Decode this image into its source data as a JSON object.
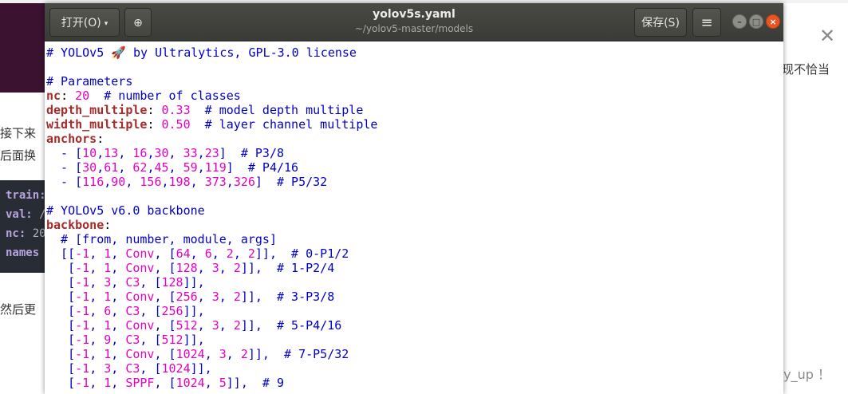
{
  "background_page": {
    "side_text": [
      "接下来",
      "后面换"
    ],
    "side_text_bottom": "然后更",
    "right_fragment": "现不恰当",
    "code_lines": [
      {
        "key": "train:",
        "val": " /"
      },
      {
        "key": "val:",
        "val": " /ho"
      },
      {
        "key": "nc:",
        "val": " 20"
      },
      {
        "key": "names",
        "val": ""
      }
    ],
    "close_glyph": "✕",
    "watermark": "CSDN @day_day_up ！"
  },
  "window": {
    "open_label": "打开(O)",
    "open_arrow": "▾",
    "newtab_glyph": "⊕",
    "title": "yolov5s.yaml",
    "path": "~/yolov5-master/models",
    "save_label": "保存(S)",
    "menu_glyph": "≡",
    "min_glyph": "–",
    "max_glyph": "□",
    "close_glyph": "×"
  },
  "editor": {
    "lines": [
      [
        {
          "t": "c",
          "v": "# YOLOv5 🚀 by Ultralytics, GPL-3.0 license"
        }
      ],
      [],
      [
        {
          "t": "c",
          "v": "# Parameters"
        }
      ],
      [
        {
          "t": "k",
          "v": "nc"
        },
        {
          "t": "p",
          "v": ": "
        },
        {
          "t": "n",
          "v": "20"
        },
        {
          "t": "c",
          "v": "  # number of classes"
        }
      ],
      [
        {
          "t": "k",
          "v": "depth_multiple"
        },
        {
          "t": "p",
          "v": ": "
        },
        {
          "t": "n",
          "v": "0.33"
        },
        {
          "t": "c",
          "v": "  # model depth multiple"
        }
      ],
      [
        {
          "t": "k",
          "v": "width_multiple"
        },
        {
          "t": "p",
          "v": ": "
        },
        {
          "t": "n",
          "v": "0.50"
        },
        {
          "t": "c",
          "v": "  # layer channel multiple"
        }
      ],
      [
        {
          "t": "k",
          "v": "anchors"
        },
        {
          "t": "p",
          "v": ":"
        }
      ],
      [
        {
          "t": "m",
          "v": "  - ["
        },
        {
          "t": "n",
          "v": "10"
        },
        {
          "t": "m",
          "v": ","
        },
        {
          "t": "n",
          "v": "13"
        },
        {
          "t": "m",
          "v": ", "
        },
        {
          "t": "n",
          "v": "16"
        },
        {
          "t": "m",
          "v": ","
        },
        {
          "t": "n",
          "v": "30"
        },
        {
          "t": "m",
          "v": ", "
        },
        {
          "t": "n",
          "v": "33"
        },
        {
          "t": "m",
          "v": ","
        },
        {
          "t": "n",
          "v": "23"
        },
        {
          "t": "m",
          "v": "]"
        },
        {
          "t": "c",
          "v": "  # P3/8"
        }
      ],
      [
        {
          "t": "m",
          "v": "  - ["
        },
        {
          "t": "n",
          "v": "30"
        },
        {
          "t": "m",
          "v": ","
        },
        {
          "t": "n",
          "v": "61"
        },
        {
          "t": "m",
          "v": ", "
        },
        {
          "t": "n",
          "v": "62"
        },
        {
          "t": "m",
          "v": ","
        },
        {
          "t": "n",
          "v": "45"
        },
        {
          "t": "m",
          "v": ", "
        },
        {
          "t": "n",
          "v": "59"
        },
        {
          "t": "m",
          "v": ","
        },
        {
          "t": "n",
          "v": "119"
        },
        {
          "t": "m",
          "v": "]"
        },
        {
          "t": "c",
          "v": "  # P4/16"
        }
      ],
      [
        {
          "t": "m",
          "v": "  - ["
        },
        {
          "t": "n",
          "v": "116"
        },
        {
          "t": "m",
          "v": ","
        },
        {
          "t": "n",
          "v": "90"
        },
        {
          "t": "m",
          "v": ", "
        },
        {
          "t": "n",
          "v": "156"
        },
        {
          "t": "m",
          "v": ","
        },
        {
          "t": "n",
          "v": "198"
        },
        {
          "t": "m",
          "v": ", "
        },
        {
          "t": "n",
          "v": "373"
        },
        {
          "t": "m",
          "v": ","
        },
        {
          "t": "n",
          "v": "326"
        },
        {
          "t": "m",
          "v": "]"
        },
        {
          "t": "c",
          "v": "  # P5/32"
        }
      ],
      [],
      [
        {
          "t": "c",
          "v": "# YOLOv5 v6.0 backbone"
        }
      ],
      [
        {
          "t": "k",
          "v": "backbone"
        },
        {
          "t": "p",
          "v": ":"
        }
      ],
      [
        {
          "t": "c",
          "v": "  # [from, number, module, args]"
        }
      ],
      [
        {
          "t": "m",
          "v": "  [["
        },
        {
          "t": "n",
          "v": "-1"
        },
        {
          "t": "m",
          "v": ", "
        },
        {
          "t": "n",
          "v": "1"
        },
        {
          "t": "m",
          "v": ", "
        },
        {
          "t": "n",
          "v": "Conv"
        },
        {
          "t": "m",
          "v": ", ["
        },
        {
          "t": "n",
          "v": "64"
        },
        {
          "t": "m",
          "v": ", "
        },
        {
          "t": "n",
          "v": "6"
        },
        {
          "t": "m",
          "v": ", "
        },
        {
          "t": "n",
          "v": "2"
        },
        {
          "t": "m",
          "v": ", "
        },
        {
          "t": "n",
          "v": "2"
        },
        {
          "t": "m",
          "v": "]],"
        },
        {
          "t": "c",
          "v": "  # 0-P1/2"
        }
      ],
      [
        {
          "t": "m",
          "v": "   ["
        },
        {
          "t": "n",
          "v": "-1"
        },
        {
          "t": "m",
          "v": ", "
        },
        {
          "t": "n",
          "v": "1"
        },
        {
          "t": "m",
          "v": ", "
        },
        {
          "t": "n",
          "v": "Conv"
        },
        {
          "t": "m",
          "v": ", ["
        },
        {
          "t": "n",
          "v": "128"
        },
        {
          "t": "m",
          "v": ", "
        },
        {
          "t": "n",
          "v": "3"
        },
        {
          "t": "m",
          "v": ", "
        },
        {
          "t": "n",
          "v": "2"
        },
        {
          "t": "m",
          "v": "]],"
        },
        {
          "t": "c",
          "v": "  # 1-P2/4"
        }
      ],
      [
        {
          "t": "m",
          "v": "   ["
        },
        {
          "t": "n",
          "v": "-1"
        },
        {
          "t": "m",
          "v": ", "
        },
        {
          "t": "n",
          "v": "3"
        },
        {
          "t": "m",
          "v": ", "
        },
        {
          "t": "n",
          "v": "C3"
        },
        {
          "t": "m",
          "v": ", ["
        },
        {
          "t": "n",
          "v": "128"
        },
        {
          "t": "m",
          "v": "]],"
        }
      ],
      [
        {
          "t": "m",
          "v": "   ["
        },
        {
          "t": "n",
          "v": "-1"
        },
        {
          "t": "m",
          "v": ", "
        },
        {
          "t": "n",
          "v": "1"
        },
        {
          "t": "m",
          "v": ", "
        },
        {
          "t": "n",
          "v": "Conv"
        },
        {
          "t": "m",
          "v": ", ["
        },
        {
          "t": "n",
          "v": "256"
        },
        {
          "t": "m",
          "v": ", "
        },
        {
          "t": "n",
          "v": "3"
        },
        {
          "t": "m",
          "v": ", "
        },
        {
          "t": "n",
          "v": "2"
        },
        {
          "t": "m",
          "v": "]],"
        },
        {
          "t": "c",
          "v": "  # 3-P3/8"
        }
      ],
      [
        {
          "t": "m",
          "v": "   ["
        },
        {
          "t": "n",
          "v": "-1"
        },
        {
          "t": "m",
          "v": ", "
        },
        {
          "t": "n",
          "v": "6"
        },
        {
          "t": "m",
          "v": ", "
        },
        {
          "t": "n",
          "v": "C3"
        },
        {
          "t": "m",
          "v": ", ["
        },
        {
          "t": "n",
          "v": "256"
        },
        {
          "t": "m",
          "v": "]],"
        }
      ],
      [
        {
          "t": "m",
          "v": "   ["
        },
        {
          "t": "n",
          "v": "-1"
        },
        {
          "t": "m",
          "v": ", "
        },
        {
          "t": "n",
          "v": "1"
        },
        {
          "t": "m",
          "v": ", "
        },
        {
          "t": "n",
          "v": "Conv"
        },
        {
          "t": "m",
          "v": ", ["
        },
        {
          "t": "n",
          "v": "512"
        },
        {
          "t": "m",
          "v": ", "
        },
        {
          "t": "n",
          "v": "3"
        },
        {
          "t": "m",
          "v": ", "
        },
        {
          "t": "n",
          "v": "2"
        },
        {
          "t": "m",
          "v": "]],"
        },
        {
          "t": "c",
          "v": "  # 5-P4/16"
        }
      ],
      [
        {
          "t": "m",
          "v": "   ["
        },
        {
          "t": "n",
          "v": "-1"
        },
        {
          "t": "m",
          "v": ", "
        },
        {
          "t": "n",
          "v": "9"
        },
        {
          "t": "m",
          "v": ", "
        },
        {
          "t": "n",
          "v": "C3"
        },
        {
          "t": "m",
          "v": ", ["
        },
        {
          "t": "n",
          "v": "512"
        },
        {
          "t": "m",
          "v": "]],"
        }
      ],
      [
        {
          "t": "m",
          "v": "   ["
        },
        {
          "t": "n",
          "v": "-1"
        },
        {
          "t": "m",
          "v": ", "
        },
        {
          "t": "n",
          "v": "1"
        },
        {
          "t": "m",
          "v": ", "
        },
        {
          "t": "n",
          "v": "Conv"
        },
        {
          "t": "m",
          "v": ", ["
        },
        {
          "t": "n",
          "v": "1024"
        },
        {
          "t": "m",
          "v": ", "
        },
        {
          "t": "n",
          "v": "3"
        },
        {
          "t": "m",
          "v": ", "
        },
        {
          "t": "n",
          "v": "2"
        },
        {
          "t": "m",
          "v": "]],"
        },
        {
          "t": "c",
          "v": "  # 7-P5/32"
        }
      ],
      [
        {
          "t": "m",
          "v": "   ["
        },
        {
          "t": "n",
          "v": "-1"
        },
        {
          "t": "m",
          "v": ", "
        },
        {
          "t": "n",
          "v": "3"
        },
        {
          "t": "m",
          "v": ", "
        },
        {
          "t": "n",
          "v": "C3"
        },
        {
          "t": "m",
          "v": ", ["
        },
        {
          "t": "n",
          "v": "1024"
        },
        {
          "t": "m",
          "v": "]],"
        }
      ],
      [
        {
          "t": "m",
          "v": "   ["
        },
        {
          "t": "n",
          "v": "-1"
        },
        {
          "t": "m",
          "v": ", "
        },
        {
          "t": "n",
          "v": "1"
        },
        {
          "t": "m",
          "v": ", "
        },
        {
          "t": "n",
          "v": "SPPF"
        },
        {
          "t": "m",
          "v": ", ["
        },
        {
          "t": "n",
          "v": "1024"
        },
        {
          "t": "m",
          "v": ", "
        },
        {
          "t": "n",
          "v": "5"
        },
        {
          "t": "m",
          "v": "]],"
        },
        {
          "t": "c",
          "v": "  # 9"
        }
      ]
    ]
  }
}
